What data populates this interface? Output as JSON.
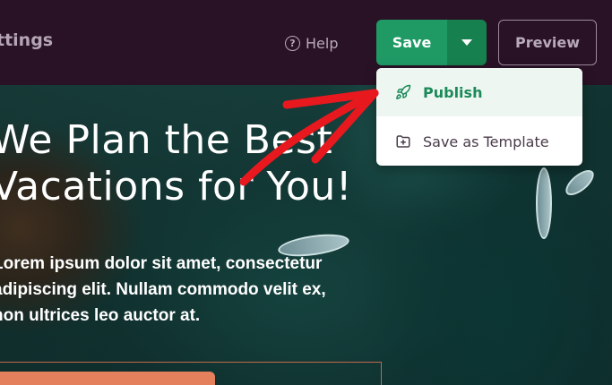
{
  "topbar": {
    "title": "ttings",
    "help_label": "Help",
    "save_label": "Save",
    "preview_label": "Preview"
  },
  "dropdown": {
    "items": [
      {
        "label": "Publish",
        "icon": "rocket-icon"
      },
      {
        "label": "Save as Template",
        "icon": "folder-plus-icon"
      }
    ]
  },
  "hero": {
    "heading_line1": "We Plan the Best",
    "heading_line2": "Vacations for You!",
    "para_line1": "Lorem ipsum dolor sit amet, consectetur",
    "para_line2": "adipiscing elit. Nullam commodo velit ex,",
    "para_line3": "non ultrices leo auctor at."
  },
  "colors": {
    "topbar_bg": "#2a1226",
    "save_green": "#1f9a65",
    "publish_text": "#1b8a59",
    "arrow_red": "#e8181f",
    "cta": "#e4805b"
  }
}
